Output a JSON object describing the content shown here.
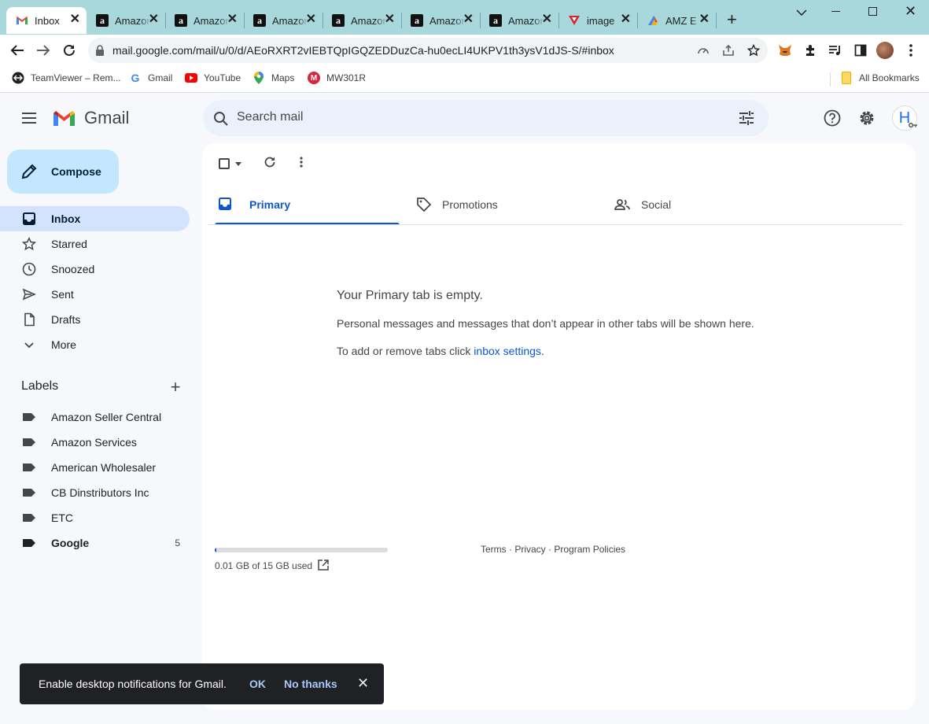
{
  "browser": {
    "tabs": [
      {
        "title": "Inbox",
        "favicon": "gmail-icon",
        "active": true
      },
      {
        "title": "Amazon",
        "favicon": "amazon-icon",
        "active": false
      },
      {
        "title": "Amazon",
        "favicon": "amazon-icon",
        "active": false
      },
      {
        "title": "Amazon",
        "favicon": "amazon-icon",
        "active": false
      },
      {
        "title": "Amazon",
        "favicon": "amazon-icon",
        "active": false
      },
      {
        "title": "Amazon",
        "favicon": "amazon-icon",
        "active": false
      },
      {
        "title": "Amazon",
        "favicon": "amazon-icon",
        "active": false
      },
      {
        "title": "image",
        "favicon": "vector-v-icon",
        "active": false
      },
      {
        "title": "AMZ E",
        "favicon": "multicolor-icon",
        "active": false
      }
    ],
    "new_tab": "+",
    "url": "mail.google.com/mail/u/0/d/AEoRXRT2vIEBTQpIGQZEDDuzCa-hu0ecLI4UKPV1th3ysV1dJS-S/#inbox",
    "bookmarks": [
      {
        "label": "TeamViewer – Rem...",
        "icon": "teamviewer-icon"
      },
      {
        "label": "Gmail",
        "icon": "google-icon"
      },
      {
        "label": "YouTube",
        "icon": "youtube-icon"
      },
      {
        "label": "Maps",
        "icon": "maps-icon"
      },
      {
        "label": "MW301R",
        "icon": "mw-icon"
      }
    ],
    "all_bookmarks": "All Bookmarks"
  },
  "gmail": {
    "logo_text": "Gmail",
    "search_placeholder": "Search mail",
    "avatar_letter": "H",
    "compose_label": "Compose",
    "nav": [
      {
        "label": "Inbox",
        "icon": "inbox-icon",
        "active": true
      },
      {
        "label": "Starred",
        "icon": "star-icon"
      },
      {
        "label": "Snoozed",
        "icon": "clock-icon"
      },
      {
        "label": "Sent",
        "icon": "send-icon"
      },
      {
        "label": "Drafts",
        "icon": "draft-icon"
      },
      {
        "label": "More",
        "icon": "chevron-down-icon"
      }
    ],
    "labels_heading": "Labels",
    "labels": [
      {
        "label": "Amazon Seller Central",
        "count": ""
      },
      {
        "label": "Amazon Services",
        "count": ""
      },
      {
        "label": "American Wholesaler",
        "count": ""
      },
      {
        "label": "CB Dinstributors Inc",
        "count": ""
      },
      {
        "label": "ETC",
        "count": ""
      },
      {
        "label": "Google",
        "count": "5",
        "bold": true
      }
    ],
    "tabs": [
      {
        "label": "Primary",
        "icon": "inbox-tab-icon",
        "active": true
      },
      {
        "label": "Promotions",
        "icon": "tag-icon"
      },
      {
        "label": "Social",
        "icon": "people-icon"
      }
    ],
    "empty": {
      "title": "Your Primary tab is empty.",
      "line1": "Personal messages and messages that don’t appear in other tabs will be shown here.",
      "line2_prefix": "To add or remove tabs click ",
      "line2_link": "inbox settings",
      "line2_suffix": "."
    },
    "storage": {
      "text": "0.01 GB of 15 GB used",
      "fraction": 0.0007
    },
    "footer": {
      "terms": "Terms",
      "sep": " · ",
      "privacy": "Privacy",
      "policies": "Program Policies"
    },
    "snackbar": {
      "text": "Enable desktop notifications for Gmail.",
      "ok": "OK",
      "no": "No thanks"
    }
  },
  "colors": {
    "accent": "#0b57d0",
    "compose": "#c2e7ff",
    "active_nav": "#d3e3fd",
    "chrome": "#a8d8dc"
  }
}
